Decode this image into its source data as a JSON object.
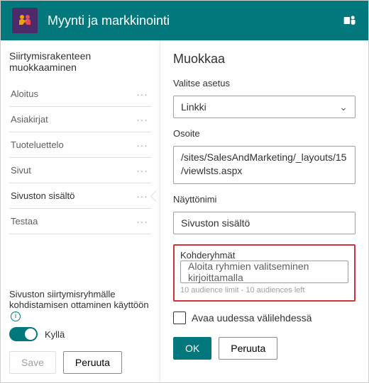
{
  "header": {
    "title": "Myynti ja markkinointi"
  },
  "left": {
    "title": "Siirtymisrakenteen muokkaaminen",
    "items": [
      {
        "label": "Aloitus"
      },
      {
        "label": "Asiakirjat"
      },
      {
        "label": "Tuoteluettelo"
      },
      {
        "label": "Sivut"
      },
      {
        "label": "Sivuston sisältö",
        "selected": true
      },
      {
        "label": "Testaa"
      }
    ],
    "audienceToggleLabel": "Sivuston siirtymisryhmälle kohdistamisen ottaminen käyttöön",
    "toggleStateLabel": "Kyllä",
    "save": "Save",
    "cancel": "Peruuta"
  },
  "panel": {
    "title": "Muokkaa",
    "settingLabel": "Valitse asetus",
    "settingValue": "Linkki",
    "addressLabel": "Osoite",
    "addressValue": "/sites/SalesAndMarketing/_layouts/15/viewlsts.aspx",
    "displayNameLabel": "Näyttönimi",
    "displayNameValue": "Sivuston sisältö",
    "audienceLabel": "Kohderyhmät",
    "audiencePlaceholder": "Aloita ryhmien valitseminen kirjoittamalla",
    "audienceHint": "10 audience limit - 10 audiences left",
    "openNewTab": "Avaa uudessa välilehdessä",
    "ok": "OK",
    "cancel": "Peruuta"
  }
}
